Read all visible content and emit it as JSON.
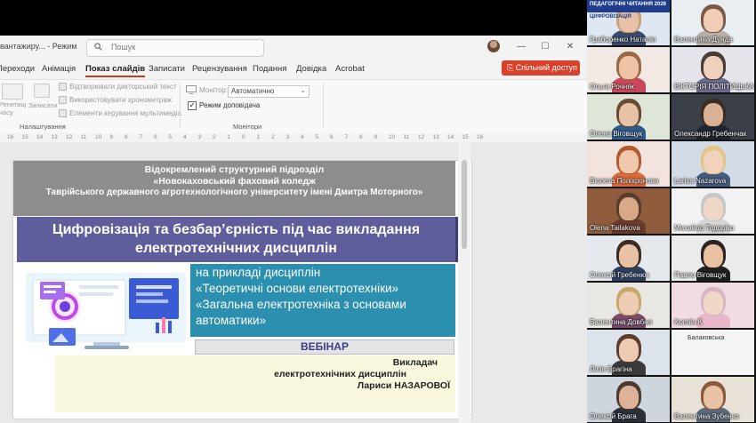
{
  "window": {
    "doc_title": "вантажиру... - Режим",
    "search_placeholder": "Пошук",
    "controls": [
      "—",
      "☐",
      "✕"
    ]
  },
  "ribbon": {
    "tabs": [
      "Переходи",
      "Анімація",
      "Показ слайдів",
      "Записати",
      "Рецензування",
      "Подання",
      "Довідка",
      "Acrobat"
    ],
    "active_tab": "Показ слайдів",
    "share_button": "Спільний доступ",
    "setup": {
      "btn1": "Репетиція часу",
      "btn2": "Записати",
      "options": [
        "Відтворювати дикторський текст",
        "Використовувати хронометраж",
        "Елементи керування мультимедіа"
      ],
      "group_label": "Налаштування"
    },
    "monitors": {
      "monitor_label": "Монітор:",
      "monitor_value": "Автоматично",
      "presenter_view": "Режим доповідача",
      "group_label": "Монітори"
    }
  },
  "ruler": [
    "16",
    "15",
    "14",
    "13",
    "12",
    "11",
    "10",
    "9",
    "8",
    "7",
    "6",
    "5",
    "4",
    "3",
    "2",
    "1",
    "0",
    "1",
    "2",
    "3",
    "4",
    "5",
    "6",
    "7",
    "8",
    "9",
    "10",
    "11",
    "12",
    "13",
    "14",
    "15",
    "16"
  ],
  "slide": {
    "org_line1": "Відокремлений структурний підрозділ",
    "org_line2": "«Новокаховський фаховий коледж",
    "org_line3": "Таврійського державного агротехнологічного університету імені Дмитра Моторного»",
    "title_line1": "Цифровізація та безбар’єрність під час викладання",
    "title_line2": "електротехнічних дисциплін",
    "sub_line1": "на прикладі дисциплін",
    "sub_line2": "«Теоретичні основи електротехніки»",
    "sub_line3": "«Загальна електротехніка з основами",
    "sub_line4": "автоматики»",
    "webinar": "ВЕБІНАР",
    "author_line1": "Викладач",
    "author_line2": "електротехнічних дисциплін",
    "author_line3": "Лариси НАЗАРОВОЇ"
  },
  "banner_texts": {
    "top_left": "ПЕДАГОГІЧНІ ЧИТАННЯ 2026",
    "top_left_sub": "ЦИФРОВІЗАЦІЯ",
    "tile_text": "Балаковська"
  },
  "participants": [
    {
      "name": "Граборенко Наталія"
    },
    {
      "name": "Валентина Дунда"
    },
    {
      "name": "Ольга Рочняк"
    },
    {
      "name": "ВІКТОРІЯ ПОЛІТИЦЬКА"
    },
    {
      "name": "Олена Віговщук"
    },
    {
      "name": "Олександр Гребенчак"
    },
    {
      "name": "Віолета Поліхронова"
    },
    {
      "name": "Larisa Nazarova"
    },
    {
      "name": "Olena Tailakova"
    },
    {
      "name": "Михайло Тодоріко"
    },
    {
      "name": "Олексій Гребенюк"
    },
    {
      "name": "Павло Віговщук"
    },
    {
      "name": "Валентина Довбня"
    },
    {
      "name": "Komila K"
    },
    {
      "name": "Лілія Брагіна"
    },
    {
      "name": ""
    },
    {
      "name": "Олексій Брага"
    },
    {
      "name": "Валентина Зубенко"
    }
  ]
}
